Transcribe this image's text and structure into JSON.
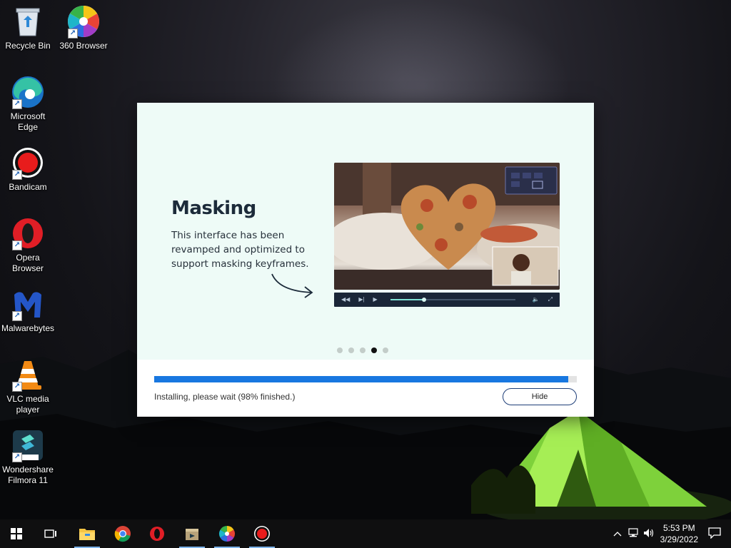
{
  "desktop": {
    "icons": [
      {
        "name": "recycle-bin",
        "label": "Recycle Bin"
      },
      {
        "name": "360-browser",
        "label": "360 Browser"
      },
      {
        "name": "microsoft-edge",
        "label": "Microsoft Edge"
      },
      {
        "name": "bandicam",
        "label": "Bandicam"
      },
      {
        "name": "opera-browser",
        "label": "Opera Browser"
      },
      {
        "name": "malwarebytes",
        "label": "Malwarebytes"
      },
      {
        "name": "vlc-media-player",
        "label": "VLC media player"
      },
      {
        "name": "wondershare-filmora",
        "label": "Wondershare Filmora 11"
      }
    ]
  },
  "installer": {
    "slide": {
      "title": "Masking",
      "description": "This interface has been revamped and optimized to support masking keyframes."
    },
    "carousel": {
      "total": 5,
      "active_index": 3
    },
    "progress": {
      "percent": 98,
      "status": "Installing, please wait (98% finished.)"
    },
    "hide_label": "Hide",
    "player": {
      "position_fraction": 0.27
    }
  },
  "taskbar": {
    "clock_time": "5:53 PM",
    "clock_date": "3/29/2022"
  },
  "colors": {
    "dialog_bg": "#eefbf7",
    "progress_fill": "#1877e0",
    "hide_border": "#1e3e78",
    "player_accent": "#7fe3d6"
  }
}
